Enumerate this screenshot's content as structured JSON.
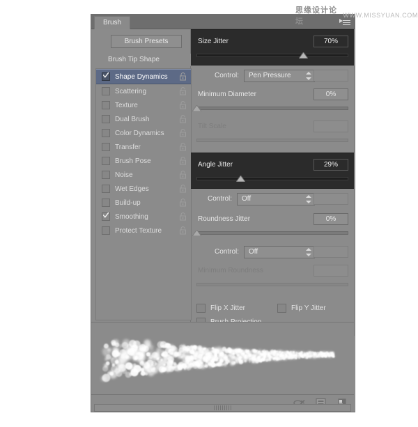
{
  "watermark": {
    "cn": "思缘设计论坛",
    "en": "WWW.MISSYUAN.COM"
  },
  "panel": {
    "tab_label": "Brush",
    "menu_icon": "panel-menu-icon"
  },
  "left": {
    "presets_button": "Brush Presets",
    "tip_shape": "Brush Tip Shape",
    "items": [
      {
        "label": "Shape Dynamics",
        "checked": true,
        "selected": true,
        "locked": false
      },
      {
        "label": "Scattering",
        "checked": false,
        "selected": false,
        "locked": false
      },
      {
        "label": "Texture",
        "checked": false,
        "selected": false,
        "locked": false
      },
      {
        "label": "Dual Brush",
        "checked": false,
        "selected": false,
        "locked": false
      },
      {
        "label": "Color Dynamics",
        "checked": false,
        "selected": false,
        "locked": false
      },
      {
        "label": "Transfer",
        "checked": false,
        "selected": false,
        "locked": false
      },
      {
        "label": "Brush Pose",
        "checked": false,
        "selected": false,
        "locked": false
      },
      {
        "label": "Noise",
        "checked": false,
        "selected": false,
        "locked": false
      },
      {
        "label": "Wet Edges",
        "checked": false,
        "selected": false,
        "locked": false
      },
      {
        "label": "Build-up",
        "checked": false,
        "selected": false,
        "locked": false
      },
      {
        "label": "Smoothing",
        "checked": true,
        "selected": false,
        "locked": false
      },
      {
        "label": "Protect Texture",
        "checked": false,
        "selected": false,
        "locked": false
      }
    ]
  },
  "right": {
    "size_jitter": {
      "label": "Size Jitter",
      "value": "70%",
      "slider_pct": 70
    },
    "size_control": {
      "label": "Control:",
      "value": "Pen Pressure"
    },
    "minimum_diameter": {
      "label": "Minimum Diameter",
      "value": "0%",
      "slider_pct": 0
    },
    "tilt_scale": {
      "label": "Tilt Scale",
      "value": "",
      "slider_pct": 0
    },
    "angle_jitter": {
      "label": "Angle Jitter",
      "value": "29%",
      "slider_pct": 29
    },
    "angle_control": {
      "label": "Control:",
      "value": "Off"
    },
    "roundness_jitter": {
      "label": "Roundness Jitter",
      "value": "0%",
      "slider_pct": 0
    },
    "roundness_control": {
      "label": "Control:",
      "value": "Off"
    },
    "minimum_roundness": {
      "label": "Minimum Roundness",
      "value": ""
    },
    "flip_x": {
      "label": "Flip X Jitter",
      "checked": false
    },
    "flip_y": {
      "label": "Flip Y Jitter",
      "checked": false
    },
    "brush_projection": {
      "label": "Brush Projection",
      "checked": false
    }
  },
  "footer": {
    "icons": [
      "toggle-brush-icon",
      "new-preset-icon",
      "delete-preset-icon"
    ]
  },
  "colors": {
    "panel_bg": "#8b8b8b",
    "dark_group": "#2b2b2b",
    "selection_blue": "#5d6a86",
    "text": "#e6e6e6",
    "text_dim": "#7d7d7d"
  }
}
